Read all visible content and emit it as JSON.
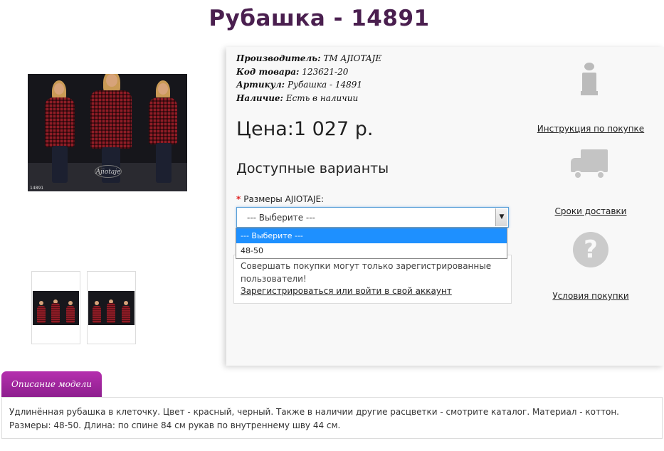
{
  "page": {
    "title": "Рубашка - 14891"
  },
  "gallery": {
    "logo_text": "Ajiotaje",
    "image_code": "14891"
  },
  "product": {
    "manufacturer_label": "Производитель:",
    "manufacturer_value": "ТМ AJIOTAJE",
    "code_label": "Код товара:",
    "code_value": "123621-20",
    "sku_label": "Артикул:",
    "sku_value": "Рубашка - 14891",
    "availability_label": "Наличие:",
    "availability_value": "Есть в наличии",
    "price": "Цена:1 027 р."
  },
  "options": {
    "title": "Доступные варианты",
    "required_mark": "*",
    "size_label": "Размеры AJIOTAJE:",
    "selected": "--- Выберите ---",
    "dropdown_items": [
      "--- Выберите ---",
      "48-50"
    ]
  },
  "notice": {
    "text": "Совершать покупки могут только зарегистрированные пользователи!",
    "link": "Зарегистрироваться или войти в свой аккаунт"
  },
  "sidebar": {
    "instruction": "Инструкция по покупке",
    "delivery": "Сроки доставки",
    "terms": "Условия покупки",
    "question_glyph": "?"
  },
  "description": {
    "tab": "Описание модели",
    "text": "Удлинённая рубашка в клеточку. Цвет - красный, черный. Также в наличии другие расцветки - смотрите каталог. Материал - коттон. Размеры: 48-50. Длина: по спине 84 см рукав по внутреннему шву 44 см."
  },
  "colors": {
    "title": "#4a1f4f",
    "tab": "#a12aa0",
    "select_highlight": "#1e90ff",
    "required": "#e02020"
  }
}
